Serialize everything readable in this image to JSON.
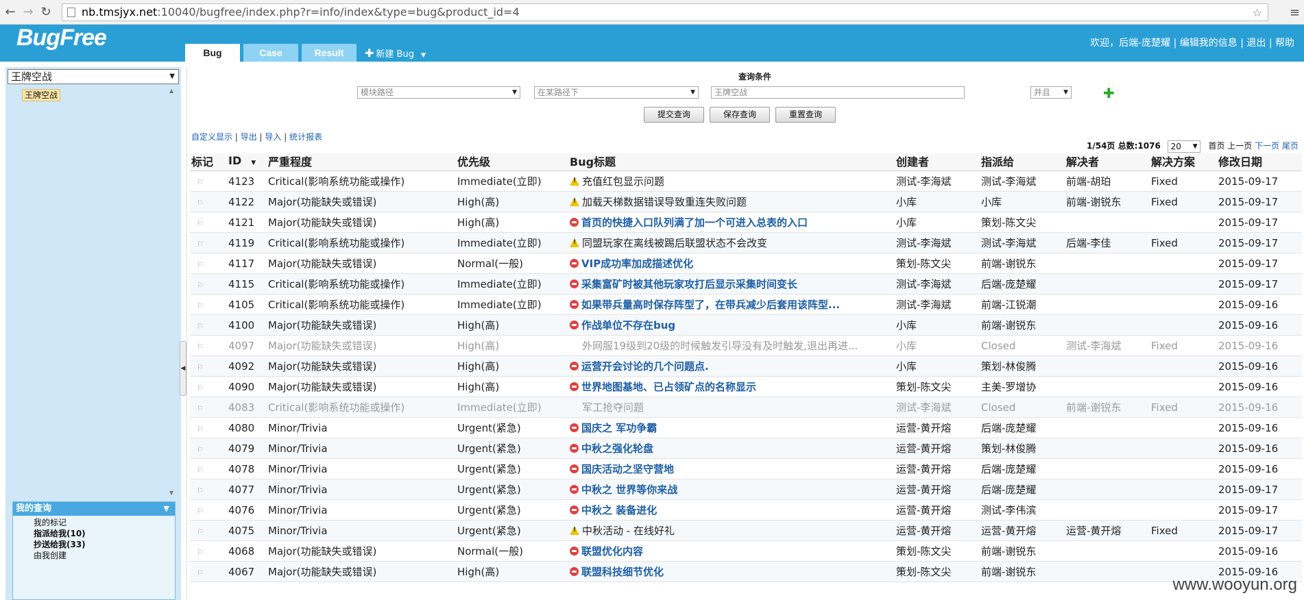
{
  "browser": {
    "url_host": "nb.tmsjyx.net",
    "url_path": ":10040/bugfree/index.php?r=info/index&type=bug&product_id=4"
  },
  "header": {
    "logo": "BugFree",
    "tabs": [
      {
        "label": "Bug",
        "active": true
      },
      {
        "label": "Case",
        "active": false
      },
      {
        "label": "Result",
        "active": false
      }
    ],
    "new_bug_label": "新建 Bug",
    "user_links": "欢迎，后端-庞楚耀 | 编辑我的信息 | 退出 | 帮助"
  },
  "sidebar": {
    "product_select": "王牌空战",
    "tree_node": "王牌空战",
    "my_query": {
      "title": "我的查询",
      "items": [
        {
          "label": "我的标记",
          "bold": false
        },
        {
          "label": "指派给我(10)",
          "bold": true
        },
        {
          "label": "抄送给我(33)",
          "bold": true
        },
        {
          "label": "由我创建",
          "bold": false
        }
      ]
    }
  },
  "query": {
    "title": "查询条件",
    "field": "模块路径",
    "operator": "在某路径下",
    "value": "王牌空战",
    "logic": "并且",
    "buttons": [
      "提交查询",
      "保存查询",
      "重置查询"
    ]
  },
  "toolbar": {
    "links": [
      "自定义显示",
      "导出",
      "导入",
      "统计报表"
    ]
  },
  "pager": {
    "info": "1/54页 总数:1076",
    "page_size": "20",
    "first": "首页",
    "prev": "上一页",
    "next": "下一页",
    "last": "尾页"
  },
  "table": {
    "columns": [
      "标记",
      "ID",
      "严重程度",
      "优先级",
      "Bug标题",
      "创建者",
      "指派给",
      "解决者",
      "解决方案",
      "修改日期"
    ],
    "rows": [
      {
        "id": "4123",
        "severity": "Critical(影响系统功能或操作)",
        "priority": "Immediate(立即)",
        "status_icon": "warning-icon",
        "title": "充值红包显示问题",
        "title_style": "plain",
        "creator": "测试-李海斌",
        "assigned": "测试-李海斌",
        "resolver": "前端-胡珀",
        "resolution": "Fixed",
        "date": "2015-09-17",
        "closed": false
      },
      {
        "id": "4122",
        "severity": "Major(功能缺失或错误)",
        "priority": "High(高)",
        "status_icon": "warning-icon",
        "title": "加载天梯数据错误导致重连失败问题",
        "title_style": "plain",
        "creator": "小库",
        "assigned": "小库",
        "resolver": "前端-谢锐东",
        "resolution": "Fixed",
        "date": "2015-09-17",
        "closed": false
      },
      {
        "id": "4121",
        "severity": "Major(功能缺失或错误)",
        "priority": "High(高)",
        "status_icon": "stop-icon",
        "title": "首页的快捷入口队列满了加一个可进入总表的入口",
        "title_style": "link",
        "creator": "小库",
        "assigned": "策划-陈文尖",
        "resolver": "",
        "resolution": "",
        "date": "2015-09-17",
        "closed": false
      },
      {
        "id": "4119",
        "severity": "Critical(影响系统功能或操作)",
        "priority": "Immediate(立即)",
        "status_icon": "warning-icon",
        "title": "同盟玩家在离线被踢后联盟状态不会改变",
        "title_style": "plain",
        "creator": "测试-李海斌",
        "assigned": "测试-李海斌",
        "resolver": "后端-李佳",
        "resolution": "Fixed",
        "date": "2015-09-17",
        "closed": false
      },
      {
        "id": "4117",
        "severity": "Major(功能缺失或错误)",
        "priority": "Normal(一般)",
        "status_icon": "stop-icon",
        "title": "VIP成功率加成描述优化",
        "title_style": "link",
        "creator": "策划-陈文尖",
        "assigned": "前端-谢锐东",
        "resolver": "",
        "resolution": "",
        "date": "2015-09-17",
        "closed": false
      },
      {
        "id": "4115",
        "severity": "Critical(影响系统功能或操作)",
        "priority": "Immediate(立即)",
        "status_icon": "stop-icon",
        "title": "采集富矿时被其他玩家攻打后显示采集时间变长",
        "title_style": "link",
        "creator": "测试-李海斌",
        "assigned": "后端-庞楚耀",
        "resolver": "",
        "resolution": "",
        "date": "2015-09-17",
        "closed": false
      },
      {
        "id": "4105",
        "severity": "Critical(影响系统功能或操作)",
        "priority": "Immediate(立即)",
        "status_icon": "stop-icon",
        "title": "如果带兵量高时保存阵型了，在带兵减少后套用该阵型...",
        "title_style": "link",
        "creator": "测试-李海斌",
        "assigned": "前端-江锐潮",
        "resolver": "",
        "resolution": "",
        "date": "2015-09-16",
        "closed": false
      },
      {
        "id": "4100",
        "severity": "Major(功能缺失或错误)",
        "priority": "High(高)",
        "status_icon": "stop-icon",
        "title": "作战单位不存在bug",
        "title_style": "link",
        "creator": "小库",
        "assigned": "前端-谢锐东",
        "resolver": "",
        "resolution": "",
        "date": "2015-09-16",
        "closed": false
      },
      {
        "id": "4097",
        "severity": "Major(功能缺失或错误)",
        "priority": "High(高)",
        "status_icon": "",
        "title": "外网服19级到20级的时候触发引导没有及时触发,退出再进...",
        "title_style": "plain",
        "creator": "小库",
        "assigned": "Closed",
        "resolver": "测试-李海斌",
        "resolution": "Fixed",
        "date": "2015-09-16",
        "closed": true
      },
      {
        "id": "4092",
        "severity": "Major(功能缺失或错误)",
        "priority": "High(高)",
        "status_icon": "stop-icon",
        "title": "运营开会讨论的几个问题点.",
        "title_style": "link",
        "creator": "小库",
        "assigned": "策划-林俊腾",
        "resolver": "",
        "resolution": "",
        "date": "2015-09-16",
        "closed": false
      },
      {
        "id": "4090",
        "severity": "Major(功能缺失或错误)",
        "priority": "High(高)",
        "status_icon": "stop-icon",
        "title": "世界地图基地、已占领矿点的名称显示",
        "title_style": "link",
        "creator": "策划-陈文尖",
        "assigned": "主美-罗增协",
        "resolver": "",
        "resolution": "",
        "date": "2015-09-16",
        "closed": false
      },
      {
        "id": "4083",
        "severity": "Critical(影响系统功能或操作)",
        "priority": "Immediate(立即)",
        "status_icon": "",
        "title": "军工抢夺问题",
        "title_style": "plain",
        "creator": "测试-李海斌",
        "assigned": "Closed",
        "resolver": "前端-谢锐东",
        "resolution": "Fixed",
        "date": "2015-09-16",
        "closed": true
      },
      {
        "id": "4080",
        "severity": "Minor/Trivia",
        "priority": "Urgent(紧急)",
        "status_icon": "stop-icon",
        "title": "国庆之 军功争霸",
        "title_style": "link",
        "creator": "运营-黄开熔",
        "assigned": "后端-庞楚耀",
        "resolver": "",
        "resolution": "",
        "date": "2015-09-16",
        "closed": false
      },
      {
        "id": "4079",
        "severity": "Minor/Trivia",
        "priority": "Urgent(紧急)",
        "status_icon": "stop-icon",
        "title": "中秋之强化轮盘",
        "title_style": "link",
        "creator": "运营-黄开熔",
        "assigned": "策划-林俊腾",
        "resolver": "",
        "resolution": "",
        "date": "2015-09-16",
        "closed": false
      },
      {
        "id": "4078",
        "severity": "Minor/Trivia",
        "priority": "Urgent(紧急)",
        "status_icon": "stop-icon",
        "title": "国庆活动之坚守营地",
        "title_style": "link",
        "creator": "运营-黄开熔",
        "assigned": "后端-庞楚耀",
        "resolver": "",
        "resolution": "",
        "date": "2015-09-16",
        "closed": false
      },
      {
        "id": "4077",
        "severity": "Minor/Trivia",
        "priority": "Urgent(紧急)",
        "status_icon": "stop-icon",
        "title": "中秋之 世界等你来战",
        "title_style": "link",
        "creator": "运营-黄开熔",
        "assigned": "后端-庞楚耀",
        "resolver": "",
        "resolution": "",
        "date": "2015-09-17",
        "closed": false
      },
      {
        "id": "4076",
        "severity": "Minor/Trivia",
        "priority": "Urgent(紧急)",
        "status_icon": "stop-icon",
        "title": "中秋之 装备进化",
        "title_style": "link",
        "creator": "运营-黄开熔",
        "assigned": "测试-李伟滨",
        "resolver": "",
        "resolution": "",
        "date": "2015-09-17",
        "closed": false
      },
      {
        "id": "4075",
        "severity": "Minor/Trivia",
        "priority": "Urgent(紧急)",
        "status_icon": "warning-icon",
        "title": "中秋活动 - 在线好礼",
        "title_style": "plain",
        "creator": "运营-黄开熔",
        "assigned": "运营-黄开熔",
        "resolver": "运营-黄开熔",
        "resolution": "Fixed",
        "date": "2015-09-17",
        "closed": false
      },
      {
        "id": "4068",
        "severity": "Major(功能缺失或错误)",
        "priority": "Normal(一般)",
        "status_icon": "stop-icon",
        "title": "联盟优化内容",
        "title_style": "link",
        "creator": "策划-陈文尖",
        "assigned": "前端-谢锐东",
        "resolver": "",
        "resolution": "",
        "date": "2015-09-16",
        "closed": false
      },
      {
        "id": "4067",
        "severity": "Major(功能缺失或错误)",
        "priority": "High(高)",
        "status_icon": "stop-icon",
        "title": "联盟科技细节优化",
        "title_style": "link",
        "creator": "策划-陈文尖",
        "assigned": "前端-谢锐东",
        "resolver": "",
        "resolution": "",
        "date": "2015-09-16",
        "closed": false
      }
    ]
  },
  "watermark": "www.wooyun.org",
  "colors": {
    "header_bg": "#2a9fd6",
    "sidebar_bg": "#cfe7f7",
    "link": "#1f5fa6",
    "warning": "#f2c200",
    "stop": "#e04040"
  }
}
